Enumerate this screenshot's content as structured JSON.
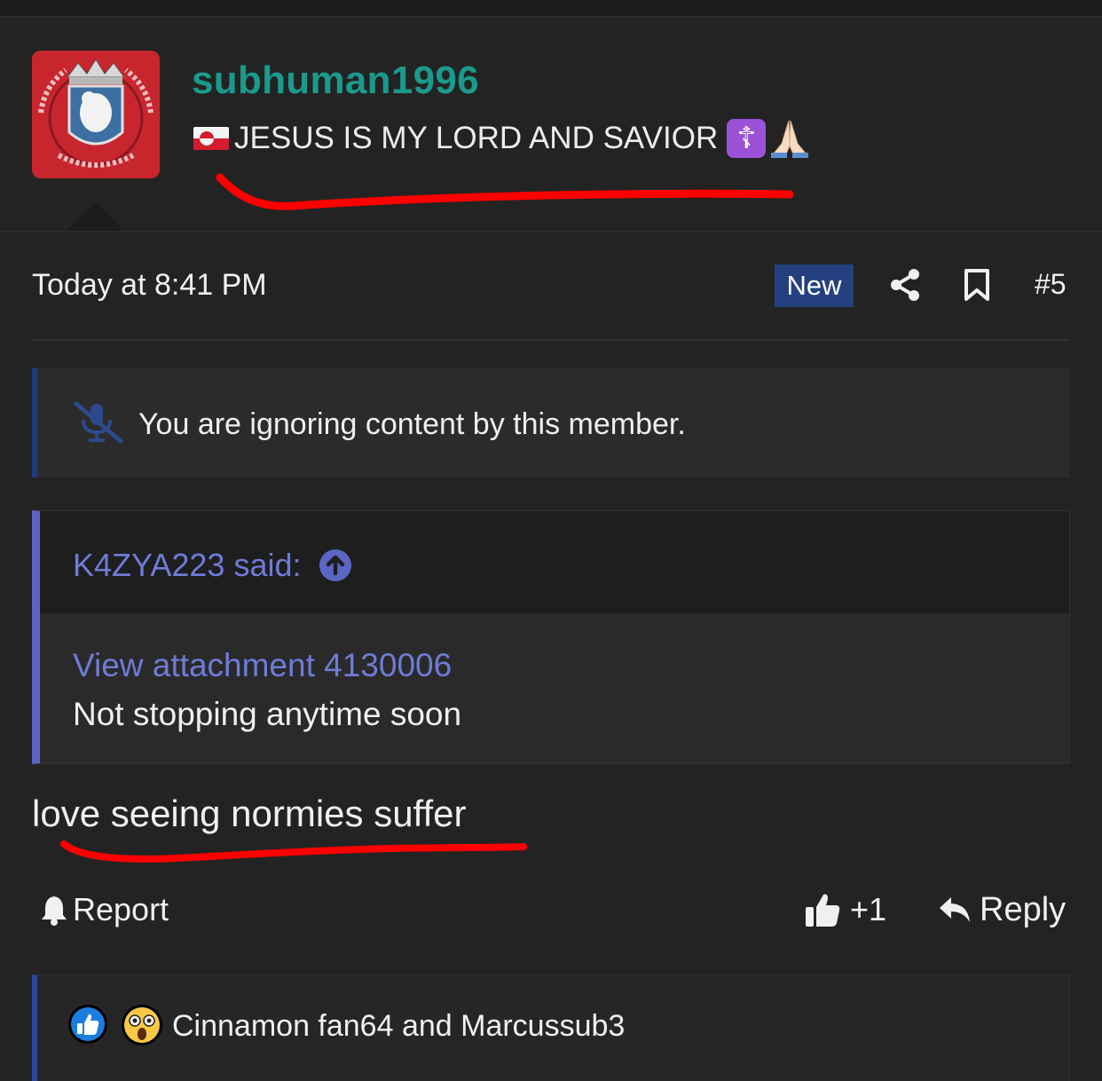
{
  "post": {
    "username": "subhuman1996",
    "user_title": "JESUS IS MY LORD AND SAVIOR",
    "date": "Today at 8:41 PM",
    "new_badge": "New",
    "post_number": "#5",
    "ignore_notice": "You are ignoring content by this member.",
    "quote": {
      "author": "K4ZYA223 said:",
      "attachment_link": "View attachment 4130006",
      "text": "Not stopping anytime soon"
    },
    "body": "love seeing normies suffer",
    "actions": {
      "report": "Report",
      "like_count": "+1",
      "reply": "Reply"
    },
    "reactions_text": "Cinnamon fan64 and Marcussub3"
  },
  "icons": [
    "greenland-flag-icon",
    "orthodox-cross-icon",
    "praying-hands-icon",
    "share-icon",
    "bookmark-icon",
    "mute-icon",
    "up-arrow-icon",
    "bell-icon",
    "thumbs-up-icon",
    "reply-icon",
    "like-reaction-icon",
    "wow-reaction-icon"
  ],
  "colors": {
    "username": "#1a9a8c",
    "link": "#6f7bd8",
    "new_badge_bg": "#24407f",
    "annotation_red": "#ff0000",
    "background": "#232323"
  }
}
